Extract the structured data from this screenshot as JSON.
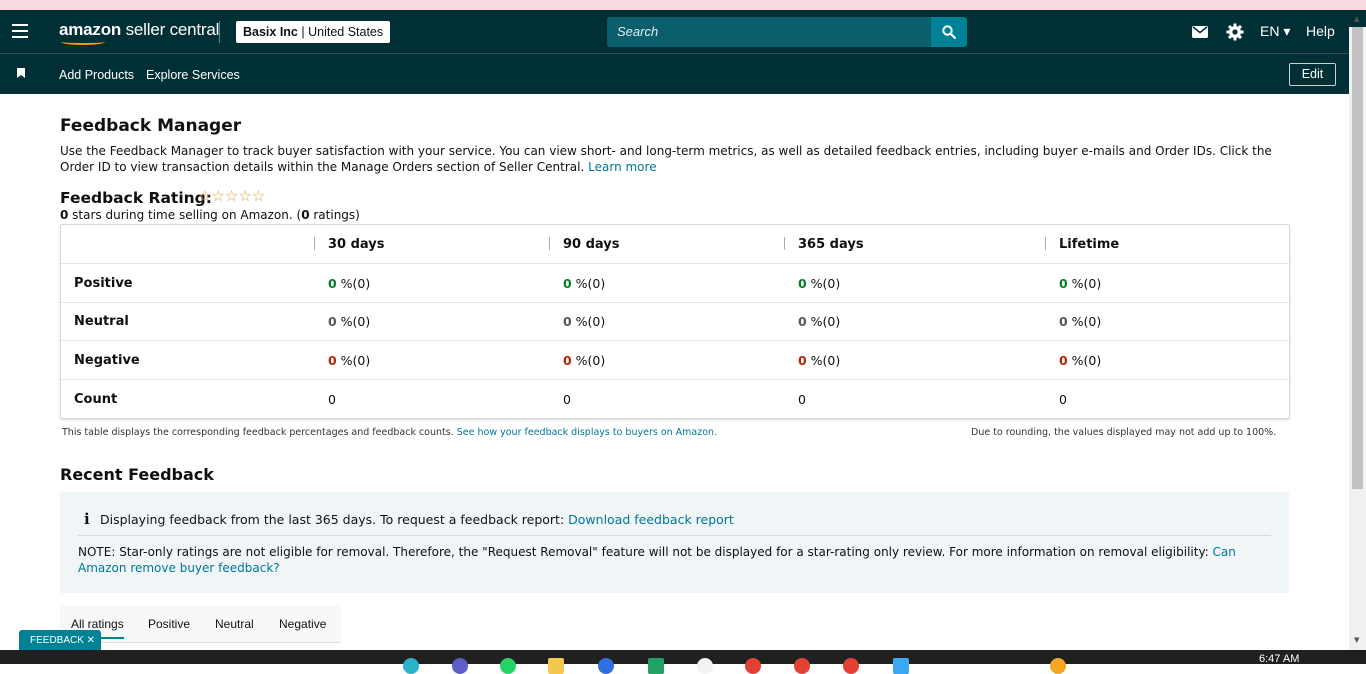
{
  "header": {
    "logo_brand": "amazon",
    "logo_product": " seller central",
    "account_name": "Basix Inc",
    "account_region": "United States",
    "search_placeholder": "Search",
    "language": "EN ▾",
    "help": "Help"
  },
  "nav": {
    "links": [
      "Add Products",
      "Explore Services"
    ],
    "edit": "Edit"
  },
  "page": {
    "title": "Feedback Manager",
    "intro": "Use the Feedback Manager to track buyer satisfaction with your service. You can view short- and long-term metrics, as well as detailed feedback entries, including buyer e-mails and Order IDs. Click the Order ID to view transaction details within the Manage Orders section of Seller Central.",
    "learn_more": "Learn more",
    "rating_title": "Feedback Rating:",
    "stars": "☆☆☆☆☆",
    "rating_stars_value": "0",
    "rating_sub_mid": " stars during time selling on Amazon. (",
    "rating_count": "0",
    "rating_sub_end": " ratings)"
  },
  "table": {
    "columns": [
      "30 days",
      "90 days",
      "365 days",
      "Lifetime"
    ],
    "rows": [
      {
        "label": "Positive",
        "cells": [
          {
            "v": "0",
            "s": " %(0)"
          },
          {
            "v": "0",
            "s": " %(0)"
          },
          {
            "v": "0",
            "s": " %(0)"
          },
          {
            "v": "0",
            "s": " %(0)"
          }
        ]
      },
      {
        "label": "Neutral",
        "cells": [
          {
            "v": "0",
            "s": " %(0)"
          },
          {
            "v": "0",
            "s": " %(0)"
          },
          {
            "v": "0",
            "s": " %(0)"
          },
          {
            "v": "0",
            "s": " %(0)"
          }
        ]
      },
      {
        "label": "Negative",
        "cells": [
          {
            "v": "0",
            "s": " %(0)"
          },
          {
            "v": "0",
            "s": " %(0)"
          },
          {
            "v": "0",
            "s": " %(0)"
          },
          {
            "v": "0",
            "s": " %(0)"
          }
        ]
      },
      {
        "label": "Count",
        "cells": [
          "0",
          "0",
          "0",
          "0"
        ]
      }
    ],
    "note_left": "This table displays the corresponding feedback percentages and feedback counts.",
    "note_left_link": "See how your feedback displays to buyers on Amazon.",
    "note_right": "Due to rounding, the values displayed may not add up to 100%."
  },
  "recent": {
    "title": "Recent Feedback",
    "info_text": "Displaying feedback from the last 365 days. To request a feedback report:",
    "info_link": "Download feedback report",
    "note_text": "NOTE: Star-only ratings are not eligible for removal. Therefore, the \"Request Removal\" feature will not be displayed for a star-rating only review. For more information on removal eligibility:",
    "note_link": "Can Amazon remove buyer feedback?",
    "tabs": [
      "All ratings",
      "Positive",
      "Neutral",
      "Negative"
    ]
  },
  "feedback_badge": "FEEDBACK ✕",
  "clock": "6:47 AM",
  "colors": {
    "header_bg": "#002f36",
    "accent": "#008296",
    "positive": "#067d2b",
    "negative": "#b12704",
    "link": "#00769a"
  }
}
